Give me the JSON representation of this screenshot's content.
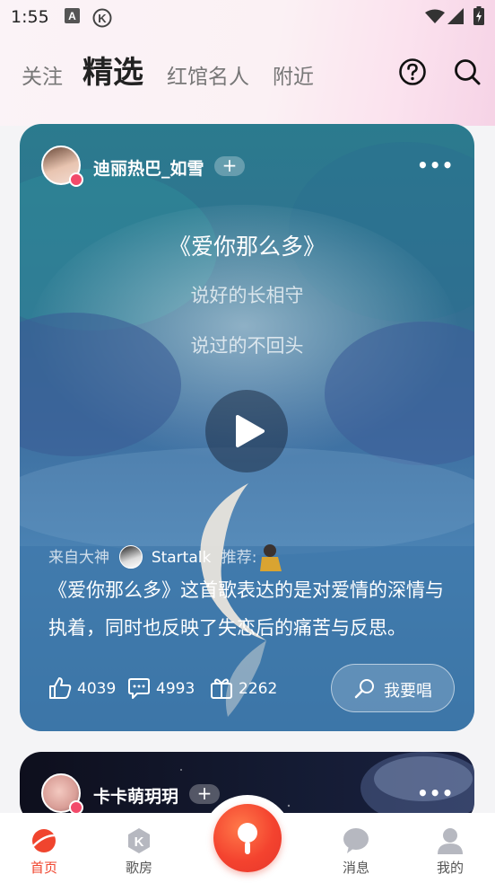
{
  "status_bar": {
    "time": "1:55"
  },
  "tabs": [
    {
      "label": "关注",
      "active": false
    },
    {
      "label": "精选",
      "active": true
    },
    {
      "label": "红馆名人",
      "active": false
    },
    {
      "label": "附近",
      "active": false
    }
  ],
  "header_icons": {
    "help": "help-circle-icon",
    "search": "search-icon"
  },
  "post1": {
    "username": "迪丽热巴_如雪",
    "follow_label": "+",
    "more_label": "•••",
    "song_title": "《爱你那么多》",
    "lyrics": [
      "说好的长相守",
      "说过的不回头"
    ],
    "from_prefix": "来自大神",
    "recommender": "Startalk",
    "recommend_suffix": "推荐:",
    "description": "《爱你那么多》这首歌表达的是对爱情的深情与执着，同时也反映了失恋后的痛苦与反思。",
    "likes": "4039",
    "comments": "4993",
    "gifts": "2262",
    "sing_label": "我要唱"
  },
  "post2": {
    "username": "卡卡萌玥玥",
    "follow_label": "+",
    "more_label": "•••"
  },
  "bottom_nav": [
    {
      "label": "首页",
      "icon": "planet-icon",
      "active": true
    },
    {
      "label": "歌房",
      "icon": "k-room-icon",
      "active": false
    },
    {
      "label": "",
      "icon": "microphone-icon",
      "active": false
    },
    {
      "label": "消息",
      "icon": "chat-bubble-icon",
      "active": false
    },
    {
      "label": "我的",
      "icon": "user-icon",
      "active": false
    }
  ],
  "colors": {
    "accent": "#f0452e",
    "badge": "#f24a6a"
  }
}
